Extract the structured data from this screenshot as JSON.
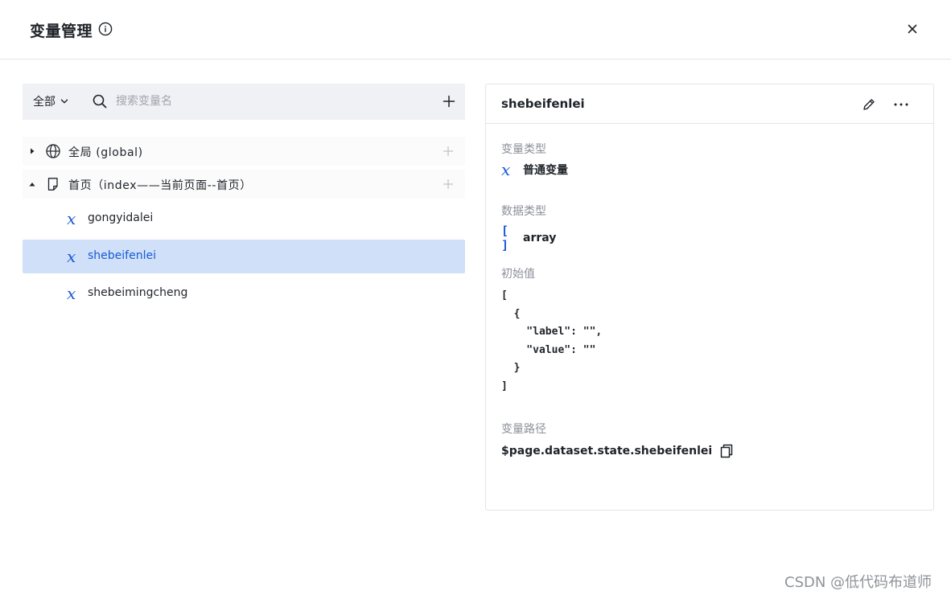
{
  "header": {
    "title": "变量管理"
  },
  "toolbar": {
    "filter_label": "全部",
    "search_placeholder": "搜索变量名"
  },
  "tree": {
    "groups": [
      {
        "label": "全局 (global)",
        "expanded": false,
        "icon": "globe-icon"
      },
      {
        "label": "首页（index——当前页面--首页）",
        "expanded": true,
        "icon": "page-icon"
      }
    ],
    "variables": [
      {
        "name": "gongyidalei",
        "selected": false
      },
      {
        "name": "shebeifenlei",
        "selected": true
      },
      {
        "name": "shebeimingcheng",
        "selected": false
      }
    ]
  },
  "detail": {
    "title": "shebeifenlei",
    "var_type_label": "变量类型",
    "var_type_value": "普通变量",
    "data_type_label": "数据类型",
    "data_type_value": "array",
    "initial_label": "初始值",
    "initial_value": "[\n  {\n    \"label\": \"\",\n    \"value\": \"\"\n  }\n]",
    "path_label": "变量路径",
    "path_value": "$page.dataset.state.shebeifenlei"
  },
  "icons": {
    "var_glyph": "x",
    "array_glyph": "[ ]"
  },
  "colors": {
    "accent": "#1a5ad6",
    "selected_bg": "#cfe0f8",
    "toolbar_bg": "#f0f1f5"
  },
  "watermark": "CSDN @低代码布道师"
}
